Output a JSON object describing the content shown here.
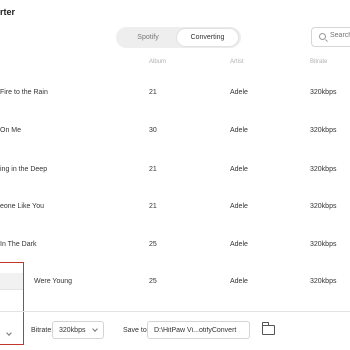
{
  "app": {
    "title_fragment": "rter"
  },
  "tabs": [
    {
      "label": "Spotify"
    },
    {
      "label": "Converting"
    }
  ],
  "search": {
    "placeholder": "Search"
  },
  "columns": {
    "album": "Album",
    "artist": "Artist",
    "bitrate": "Bitrate"
  },
  "rows": [
    {
      "title": "Fire to the Rain",
      "album": "21",
      "artist": "Adele",
      "bitrate": "320kbps"
    },
    {
      "title": "On Me",
      "album": "30",
      "artist": "Adele",
      "bitrate": "320kbps"
    },
    {
      "title": "ing in the Deep",
      "album": "21",
      "artist": "Adele",
      "bitrate": "320kbps"
    },
    {
      "title": "eone Like You",
      "album": "21",
      "artist": "Adele",
      "bitrate": "320kbps"
    },
    {
      "title": "In The Dark",
      "album": "25",
      "artist": "Adele",
      "bitrate": "320kbps"
    },
    {
      "title": "Were Young",
      "album": "25",
      "artist": "Adele",
      "bitrate": "320kbps"
    }
  ],
  "footer": {
    "bitrate_label": "Bitrate:",
    "bitrate_value": "320kbps",
    "save_label": "Save to:",
    "save_path": "D:\\HitPaw Vi...otifyConvert"
  },
  "colors": {
    "highlight": "#c0392b",
    "accent": "#f1f1f1"
  }
}
